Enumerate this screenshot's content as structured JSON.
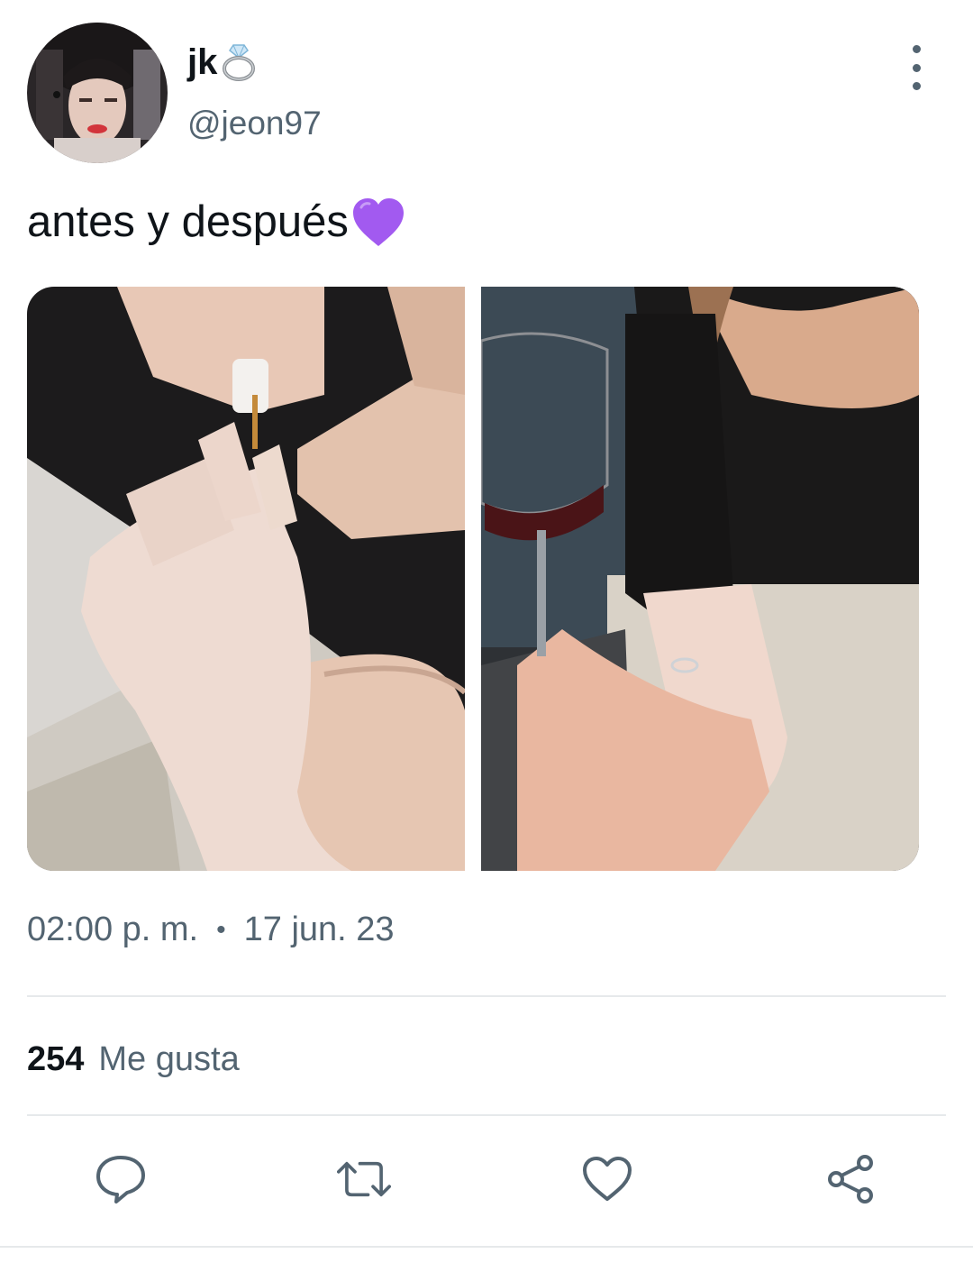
{
  "tweet": {
    "display_name": "jk",
    "display_name_emoji": "ring-emoji",
    "handle": "@jeon97",
    "text": "antes y después",
    "text_emoji": "purple-heart-emoji",
    "media": [
      {
        "description_icon": "photo-1"
      },
      {
        "description_icon": "photo-2"
      }
    ],
    "time": "02:00 p. m.",
    "separator": "•",
    "date": "17 jun. 23",
    "likes_count": "254",
    "likes_label": "Me gusta"
  },
  "icons": {
    "more": "more-vertical-icon",
    "reply": "reply-icon",
    "retweet": "retweet-icon",
    "like": "heart-icon",
    "share": "share-icon"
  },
  "colors": {
    "text_primary": "#0f1419",
    "text_secondary": "#536471",
    "divider": "#e6e9eb",
    "purple_heart": "#a25af0"
  }
}
